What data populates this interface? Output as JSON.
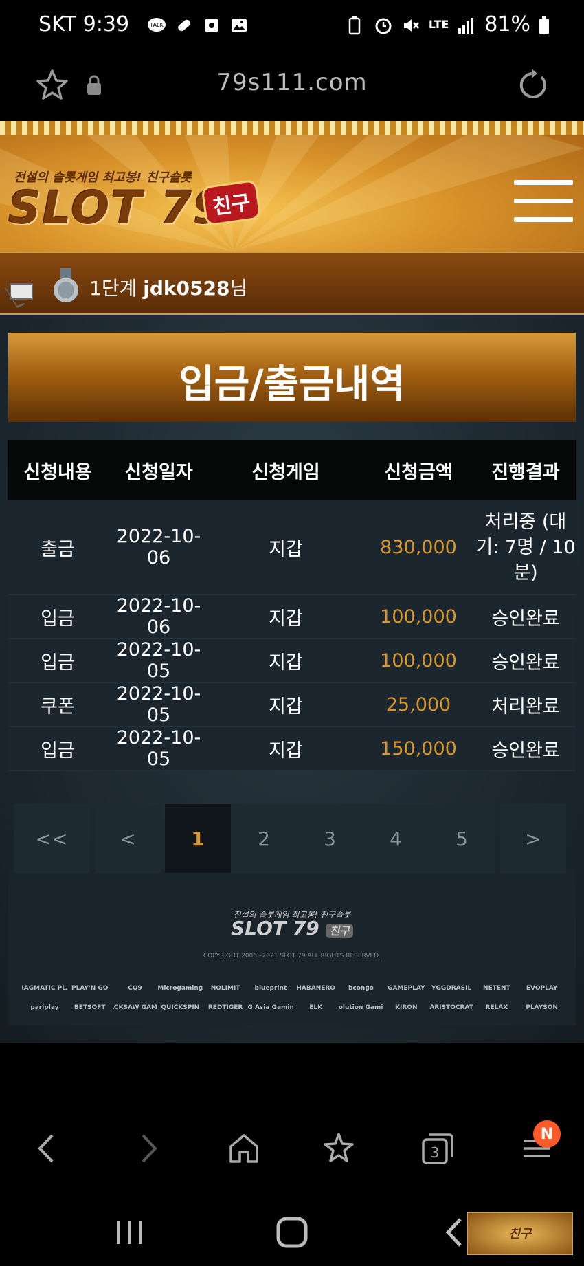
{
  "status_bar": {
    "carrier": "SKT",
    "time": "9:39",
    "network": "LTE",
    "battery": "81%",
    "icons": [
      "talk-icon",
      "pill-icon",
      "recorder-icon",
      "gallery-icon",
      "battery-saver-icon",
      "alarm-icon",
      "mute-icon",
      "lte-icon",
      "signal-icon",
      "battery-icon"
    ]
  },
  "browser": {
    "url": "79s111.com",
    "tabs_count": "3",
    "notification_badge": "N"
  },
  "site": {
    "logo_tagline": "전설의 슬롯게임 최고봉! 친구슬롯",
    "logo_main": "SLOT 79",
    "logo_badge": "친구",
    "user_level": "1단계",
    "user_name": "jdk0528",
    "user_suffix": "님"
  },
  "page": {
    "title": "입금/출금내역"
  },
  "table": {
    "headers": [
      "신청내용",
      "신청일자",
      "신청게임",
      "신청금액",
      "진행결과"
    ],
    "rows": [
      {
        "type": "출금",
        "date": "2022-10-06",
        "game": "지갑",
        "amount": "830,000",
        "result": "처리중 (대기: 7명 / 10분)"
      },
      {
        "type": "입금",
        "date": "2022-10-06",
        "game": "지갑",
        "amount": "100,000",
        "result": "승인완료"
      },
      {
        "type": "입금",
        "date": "2022-10-05",
        "game": "지갑",
        "amount": "100,000",
        "result": "승인완료"
      },
      {
        "type": "쿠폰",
        "date": "2022-10-05",
        "game": "지갑",
        "amount": "25,000",
        "result": "처리완료"
      },
      {
        "type": "입금",
        "date": "2022-10-05",
        "game": "지갑",
        "amount": "150,000",
        "result": "승인완료"
      }
    ]
  },
  "pagination": {
    "first": "<<",
    "prev": "<",
    "pages": [
      "1",
      "2",
      "3",
      "4",
      "5"
    ],
    "current": "1",
    "next": ">"
  },
  "footer": {
    "logo_tagline": "전설의 슬롯게임 최고봉! 친구슬롯",
    "logo_main": "SLOT 79",
    "logo_badge": "친구",
    "copyright": "COPYRIGHT 2006~2021 SLOT 79 ALL RIGHTS RESERVED.",
    "providers": [
      "PRAGMATIC PLAY",
      "PLAY'N GO",
      "CQ9",
      "Microgaming",
      "NOLIMIT",
      "blueprint",
      "HABANERO",
      "bcongo",
      "GAMEPLAY",
      "YGGDRASIL",
      "NETENT",
      "EVOPLAY",
      "pariplay",
      "BETSOFT",
      "HACKSAW GAMES",
      "QUICKSPIN",
      "REDTIGER",
      "AG Asia Gaming",
      "ELK",
      "Evolution Gaming",
      "KIRON",
      "ARISTOCRAT",
      "RELAX",
      "PLAYSON"
    ]
  },
  "colors": {
    "accent_gold": "#d9962a",
    "header_orange": "#d8922a",
    "table_bg": "#1b262e"
  }
}
